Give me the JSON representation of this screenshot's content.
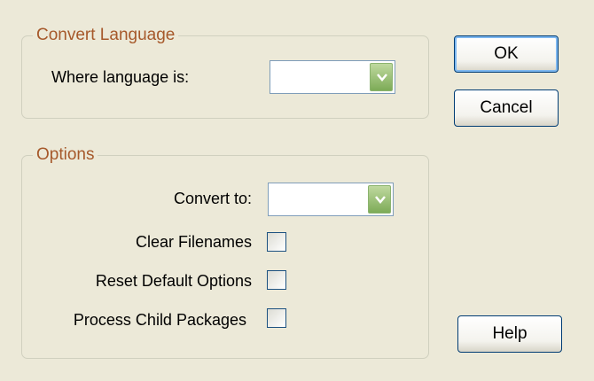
{
  "convert_language": {
    "title": "Convert Language",
    "where_label": "Where language is:",
    "where_value": ""
  },
  "options": {
    "title": "Options",
    "convert_to_label": "Convert to:",
    "convert_to_value": "",
    "checkboxes": [
      {
        "label": "Clear Filenames",
        "checked": false
      },
      {
        "label": "Reset Default Options",
        "checked": false
      },
      {
        "label": "Process Child Packages",
        "checked": false
      }
    ]
  },
  "buttons": {
    "ok": "OK",
    "cancel": "Cancel",
    "help": "Help"
  },
  "icons": {
    "dropdown": "chevron-down-icon"
  },
  "colors": {
    "group_title": "#a6592b",
    "background": "#ece9d8",
    "button_border": "#003c74"
  }
}
